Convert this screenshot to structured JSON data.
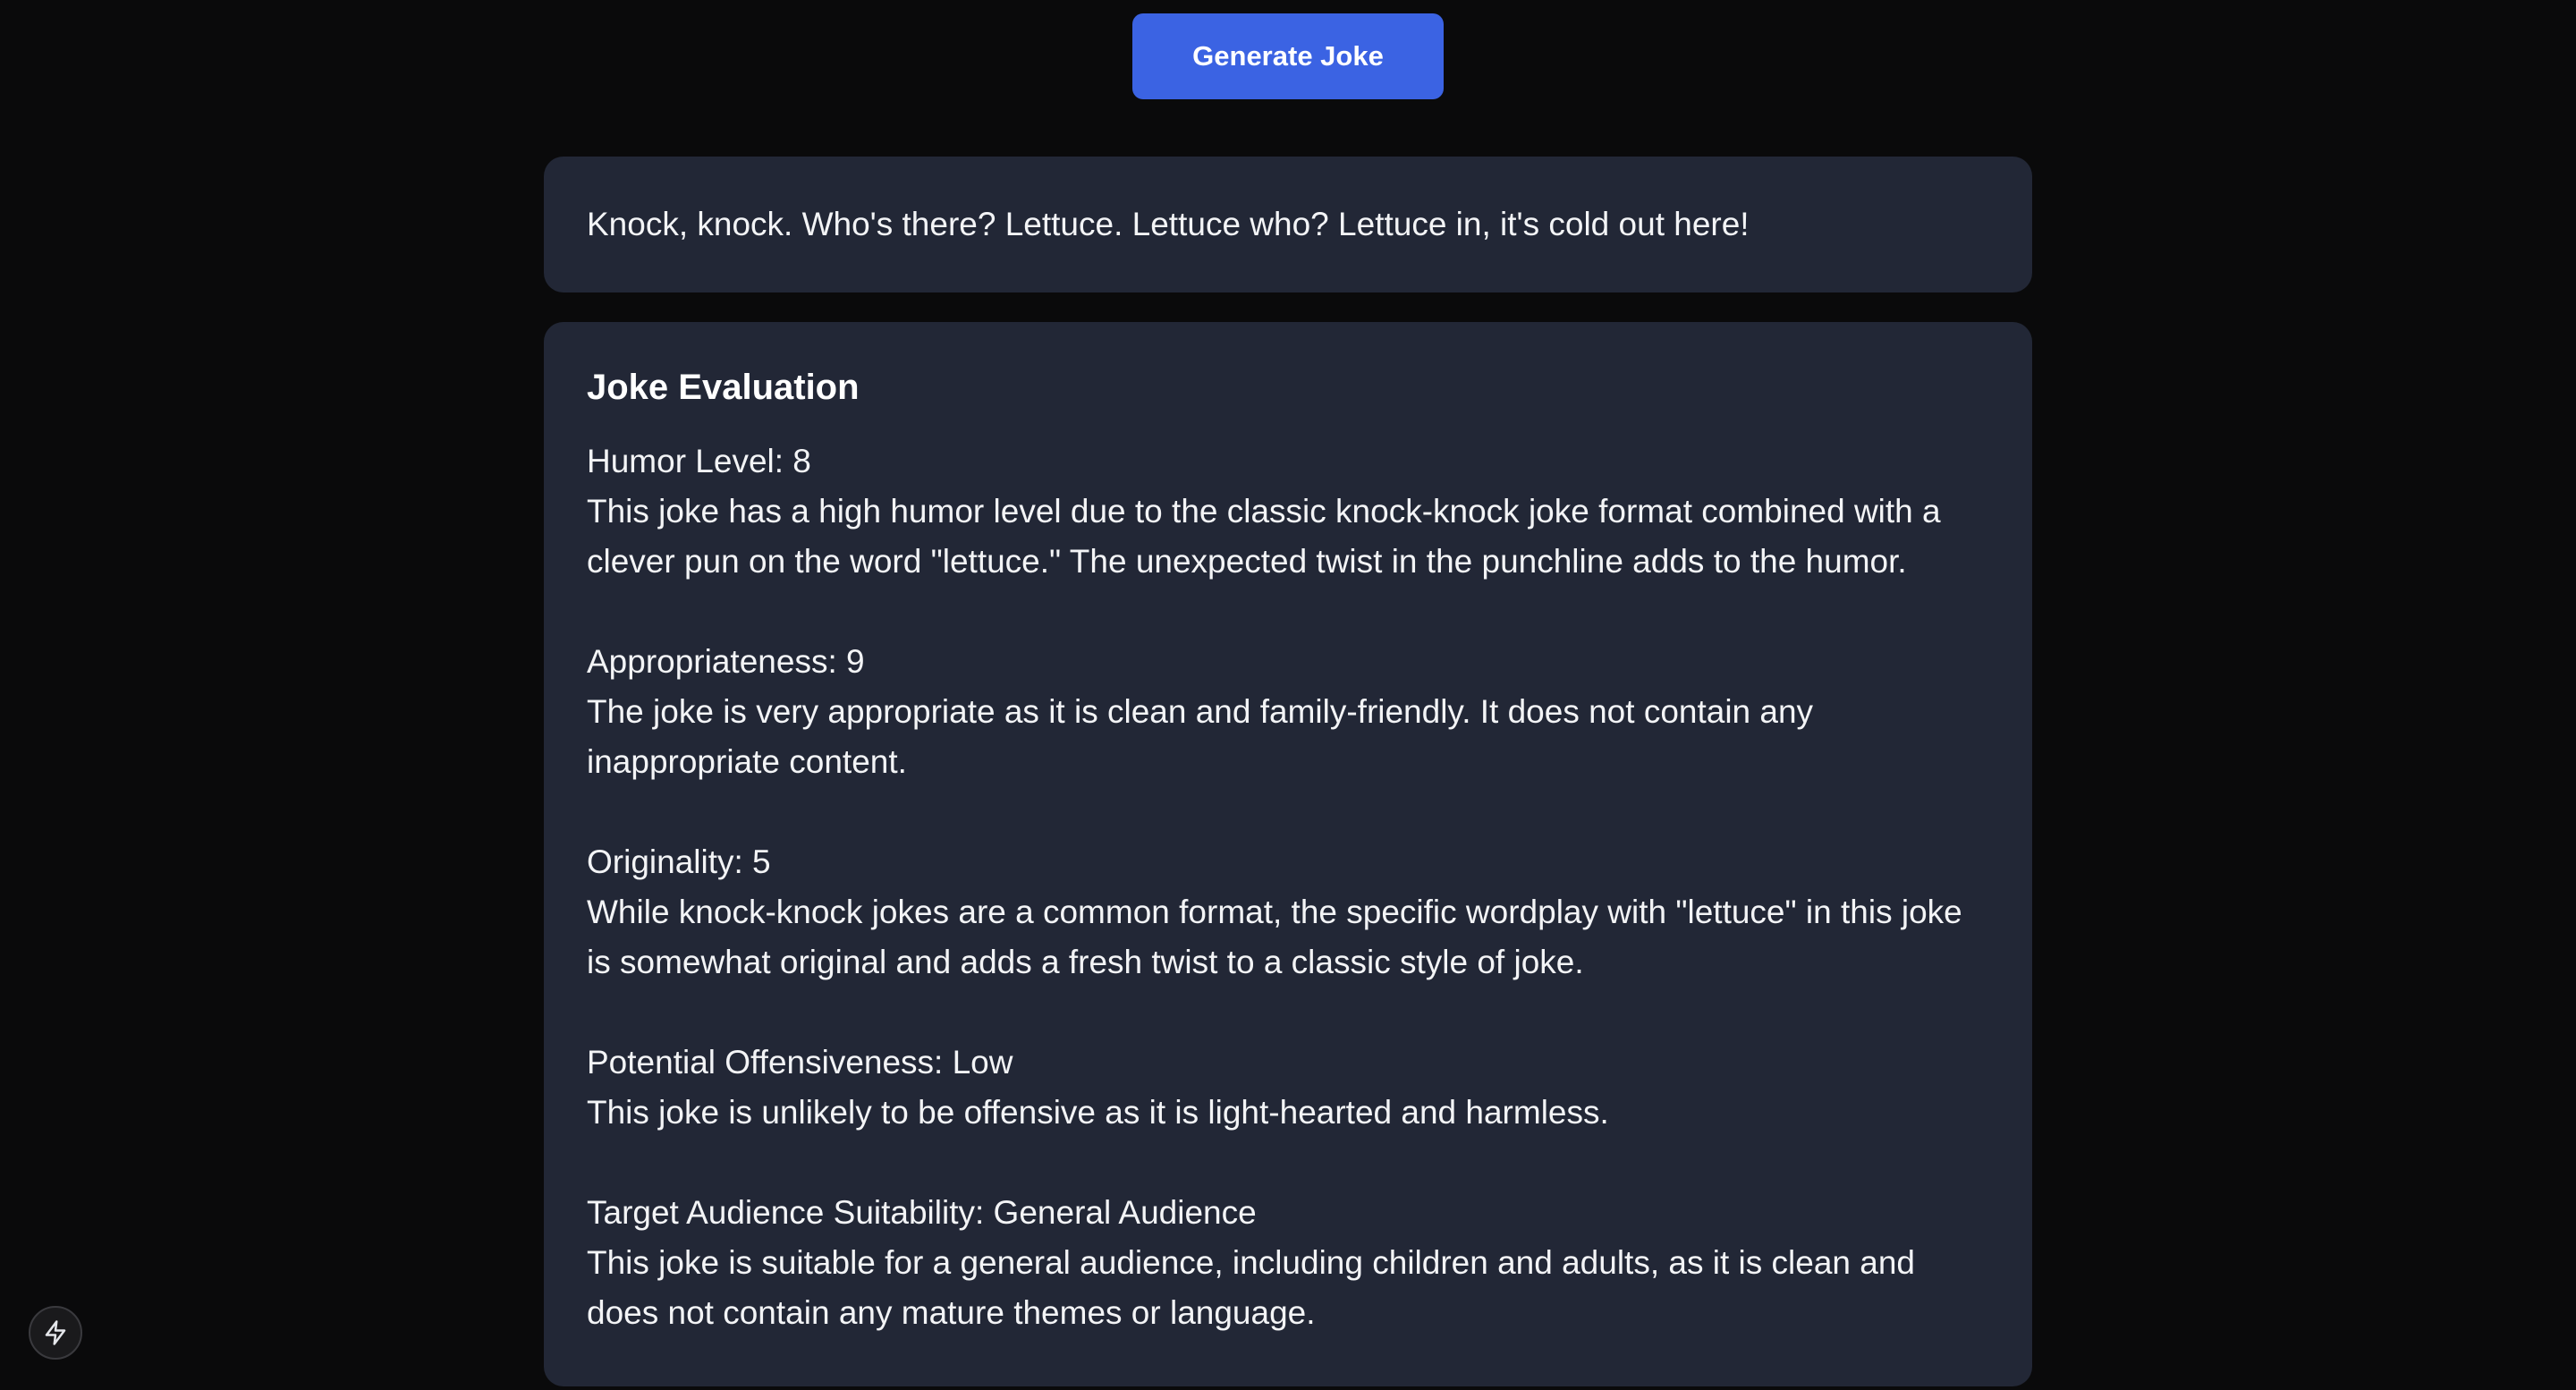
{
  "toolbar": {
    "generate_label": "Generate Joke",
    "accent_color": "#3b63e3"
  },
  "joke": {
    "text": "Knock, knock. Who's there? Lettuce. Lettuce who? Lettuce in, it's cold out here!"
  },
  "evaluation": {
    "title": "Joke Evaluation",
    "sections": [
      {
        "heading": "Humor Level: 8",
        "body": "This joke has a high humor level due to the classic knock-knock joke format combined with a clever pun on the word \"lettuce.\" The unexpected twist in the punchline adds to the humor."
      },
      {
        "heading": "Appropriateness: 9",
        "body": "The joke is very appropriate as it is clean and family-friendly. It does not contain any inappropriate content."
      },
      {
        "heading": "Originality: 5",
        "body": "While knock-knock jokes are a common format, the specific wordplay with \"lettuce\" in this joke is somewhat original and adds a fresh twist to a classic style of joke."
      },
      {
        "heading": "Potential Offensiveness: Low",
        "body": "This joke is unlikely to be offensive as it is light-hearted and harmless."
      },
      {
        "heading": "Target Audience Suitability: General Audience",
        "body": "This joke is suitable for a general audience, including children and adults, as it is clean and does not contain any mature themes or language."
      }
    ]
  },
  "dev_indicator": {
    "icon": "lightning-bolt-icon"
  }
}
